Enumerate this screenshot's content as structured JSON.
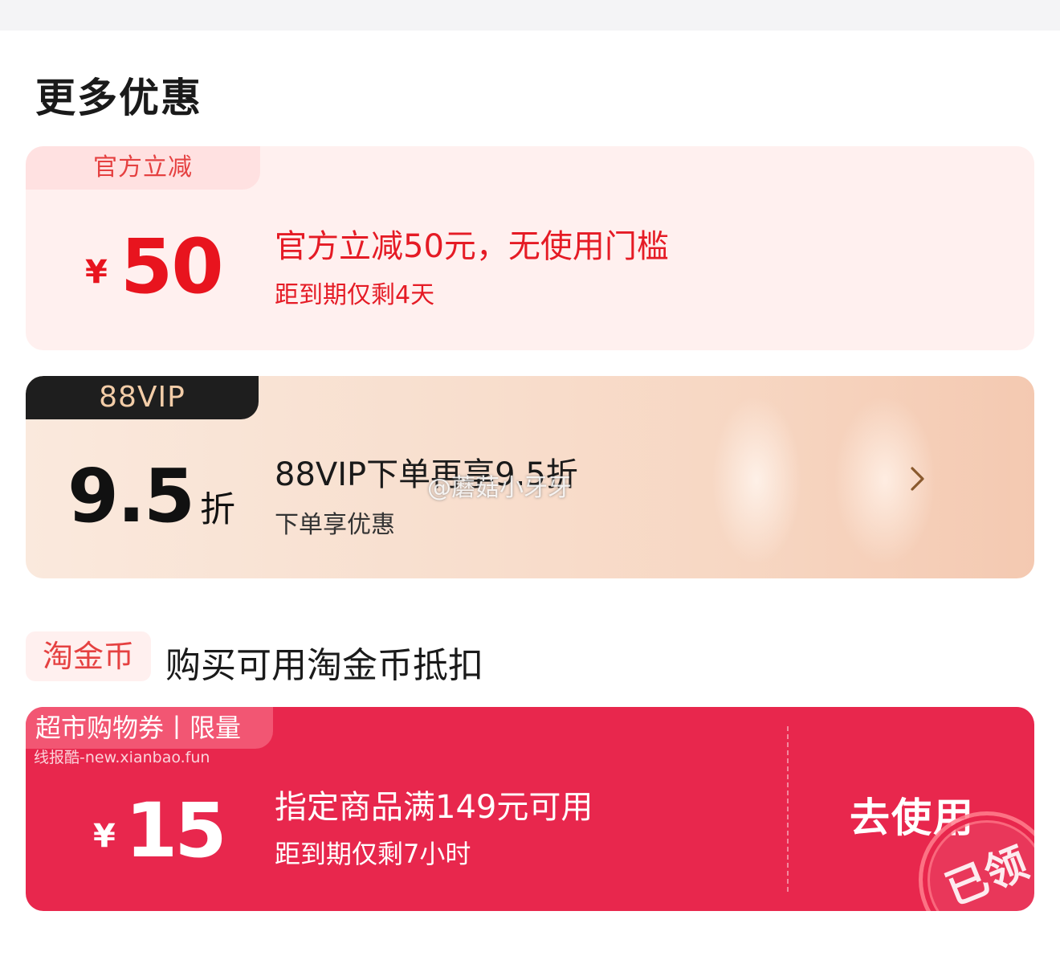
{
  "section": {
    "title": "更多优惠"
  },
  "official_coupon": {
    "tag": "官方立减",
    "currency": "¥",
    "amount": "50",
    "title": "官方立减50元，无使用门槛",
    "expiry": "距到期仅剩4天"
  },
  "vip_offer": {
    "tag": "88VIP",
    "discount": "9.5",
    "discount_unit": "折",
    "title": "88VIP下单再享9.5折",
    "subtitle": "下单享优惠",
    "watermark": "@蘑菇小牙牙",
    "chevron_icon": "chevron-right-icon"
  },
  "coin": {
    "badge": "淘金币",
    "text": "购买可用淘金币抵扣"
  },
  "supermarket_coupon": {
    "tag": "超市购物券丨限量",
    "site_mark": "线报酷-new.xianbao.fun",
    "currency": "¥",
    "amount": "15",
    "title": "指定商品满149元可用",
    "expiry": "距到期仅剩7小时",
    "action": "去使用",
    "stamp": "已领"
  },
  "colors": {
    "accent_red": "#e8141e",
    "voucher_red": "#e8274d",
    "vip_gold": "#f3cda8"
  }
}
